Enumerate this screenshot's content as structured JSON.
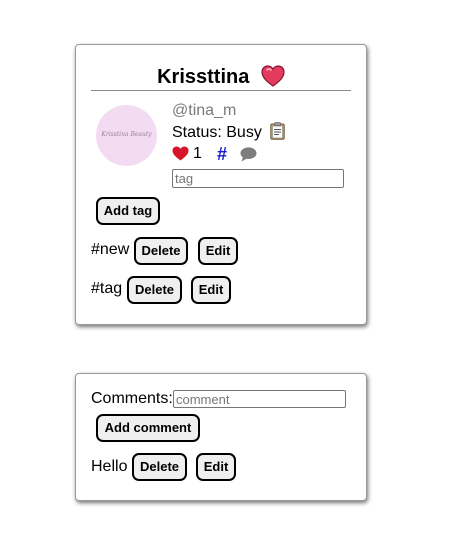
{
  "profile": {
    "username": "Krissttina",
    "handle": "@tina_m",
    "status_text": "Status: Busy",
    "like_count": "1",
    "avatar_text": "Krisstina Beauty",
    "tag_input": {
      "value": "",
      "placeholder": "tag"
    },
    "add_tag_label": "Add tag",
    "tags": [
      {
        "label": "#new",
        "delete_label": "Delete",
        "edit_label": "Edit"
      },
      {
        "label": "#tag",
        "delete_label": "Delete",
        "edit_label": "Edit"
      }
    ]
  },
  "comments": {
    "label": "Comments:",
    "input": {
      "value": "",
      "placeholder": "comment"
    },
    "add_comment_label": "Add comment",
    "items": [
      {
        "text": "Hello",
        "delete_label": "Delete",
        "edit_label": "Edit"
      }
    ]
  },
  "icons": {
    "username_emoji": "heart-emoji",
    "status_emoji": "clipboard-icon",
    "like": "heart-icon",
    "tags": "hash-icon",
    "comments": "speech-bubble-icon"
  },
  "colors": {
    "heart_red": "#d6142a",
    "hash_blue": "#1a1ad6",
    "chat_gray": "#7d7d7d",
    "avatar_bg": "#f3dcf1"
  }
}
